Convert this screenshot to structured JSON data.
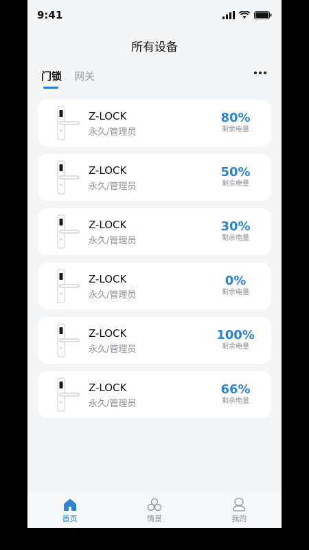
{
  "status_bar": {
    "time": "9:41"
  },
  "header": {
    "title": "所有设备"
  },
  "tabs": [
    {
      "label": "门锁",
      "active": true
    },
    {
      "label": "网关",
      "active": false
    }
  ],
  "devices": [
    {
      "name": "Z-LOCK",
      "subtitle": "永久/管理员",
      "battery": "80%",
      "battery_label": "剩余电量"
    },
    {
      "name": "Z-LOCK",
      "subtitle": "永久/管理员",
      "battery": "50%",
      "battery_label": "剩余电量"
    },
    {
      "name": "Z-LOCK",
      "subtitle": "永久/管理员",
      "battery": "30%",
      "battery_label": "剩余电量"
    },
    {
      "name": "Z-LOCK",
      "subtitle": "永久/管理员",
      "battery": "0%",
      "battery_label": "剩余电量"
    },
    {
      "name": "Z-LOCK",
      "subtitle": "永久/管理员",
      "battery": "100%",
      "battery_label": "剩余电量"
    },
    {
      "name": "Z-LOCK",
      "subtitle": "永久/管理员",
      "battery": "66%",
      "battery_label": "剩余电量"
    }
  ],
  "tab_bar": [
    {
      "label": "首页",
      "icon": "home-icon",
      "active": true
    },
    {
      "label": "情景",
      "icon": "scene-icon",
      "active": false
    },
    {
      "label": "我的",
      "icon": "profile-icon",
      "active": false
    }
  ],
  "colors": {
    "accent": "#2b84d6",
    "background": "#f4f5f7"
  }
}
